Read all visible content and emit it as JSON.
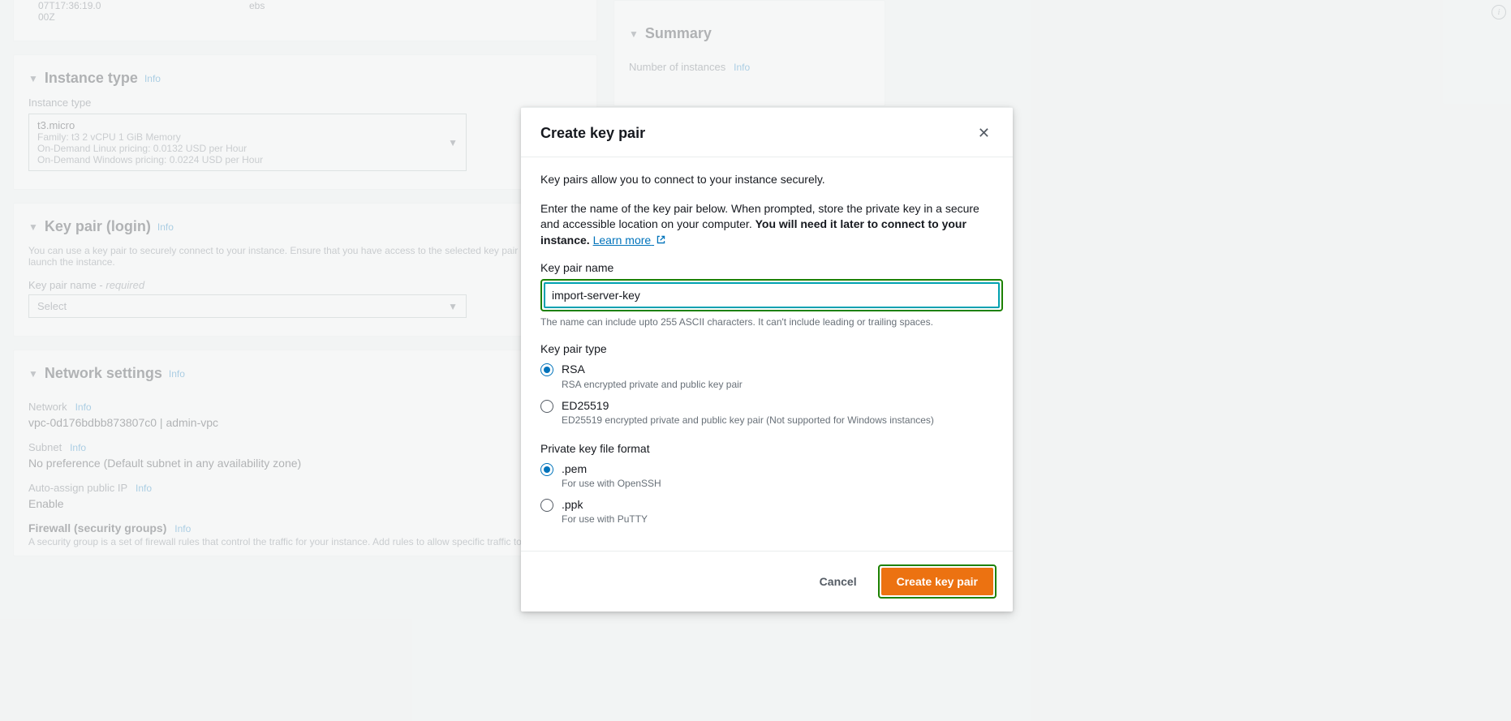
{
  "background": {
    "row_top": {
      "col1_line1": "07T17:36:19.0",
      "col1_line2": "00Z",
      "col2": "ebs"
    },
    "instance_type": {
      "title": "Instance type",
      "info": "Info",
      "label": "Instance type",
      "selected": "t3.micro",
      "meta1": "Family: t3    2 vCPU    1 GiB Memory",
      "meta2": "On-Demand Linux pricing: 0.0132 USD per Hour",
      "meta3": "On-Demand Windows pricing: 0.0224 USD per Hour"
    },
    "key_pair": {
      "title": "Key pair (login)",
      "info": "Info",
      "desc": "You can use a key pair to securely connect to your instance. Ensure that you have access to the selected key pair before you launch the instance.",
      "label": "Key pair name - ",
      "required": "required",
      "placeholder": "Select"
    },
    "network": {
      "title": "Network settings",
      "info": "Info",
      "network_label": "Network",
      "network_value": "vpc-0d176bdbb873807c0 | admin-vpc",
      "subnet_label": "Subnet",
      "subnet_value": "No preference (Default subnet in any availability zone)",
      "autoip_label": "Auto-assign public IP",
      "autoip_value": "Enable",
      "firewall_label": "Firewall (security groups)",
      "firewall_desc": "A security group is a set of firewall rules that control the traffic for your instance. Add rules to allow specific traffic to reach your"
    },
    "summary": {
      "title": "Summary",
      "num_instances_label": "Number of instances",
      "info": "Info"
    }
  },
  "modal": {
    "title": "Create key pair",
    "intro": "Key pairs allow you to connect to your instance securely.",
    "para2_a": "Enter the name of the key pair below. When prompted, store the private key in a secure and accessible location on your computer. ",
    "para2_b": "You will need it later to connect to your instance.",
    "learn_more": "Learn more",
    "name_label": "Key pair name",
    "name_value": "import-server-key",
    "name_help": "The name can include upto 255 ASCII characters. It can't include leading or trailing spaces.",
    "type_label": "Key pair type",
    "type_options": [
      {
        "label": "RSA",
        "desc": "RSA encrypted private and public key pair",
        "checked": true
      },
      {
        "label": "ED25519",
        "desc": "ED25519 encrypted private and public key pair (Not supported for Windows instances)",
        "checked": false
      }
    ],
    "format_label": "Private key file format",
    "format_options": [
      {
        "label": ".pem",
        "desc": "For use with OpenSSH",
        "checked": true
      },
      {
        "label": ".ppk",
        "desc": "For use with PuTTY",
        "checked": false
      }
    ],
    "cancel": "Cancel",
    "create": "Create key pair"
  }
}
